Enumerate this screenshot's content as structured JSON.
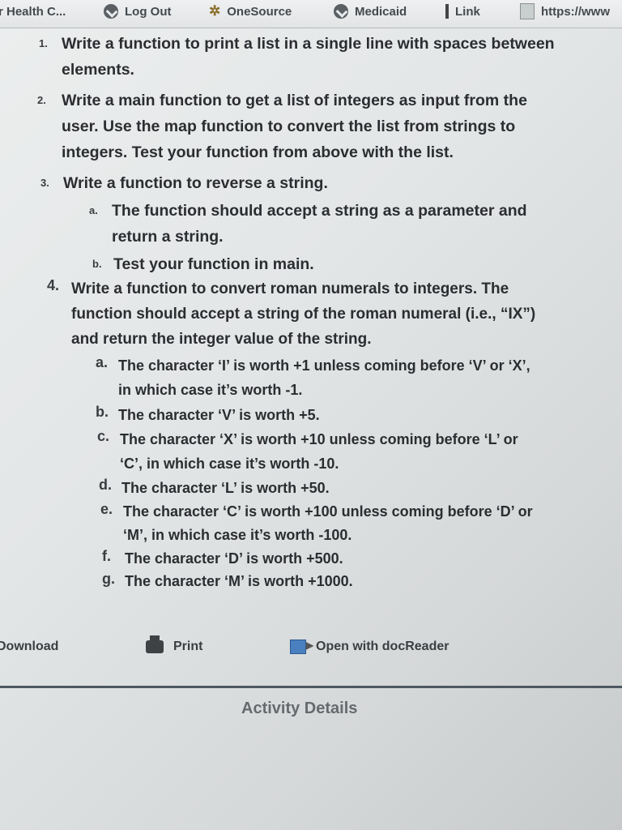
{
  "bookmarks": [
    {
      "label": "r Health C...",
      "icon": "none"
    },
    {
      "label": "Log Out",
      "icon": "check-circle-icon"
    },
    {
      "label": "OneSource",
      "icon": "gear-icon"
    },
    {
      "label": "Medicaid",
      "icon": "check-circle-icon"
    },
    {
      "label": "Link",
      "icon": "bar-icon"
    },
    {
      "label": "https://www",
      "icon": "document-icon"
    }
  ],
  "content": {
    "i1": {
      "num": "1.",
      "lines": [
        "Write a function to print a list in a single line with spaces between",
        "elements."
      ]
    },
    "i2": {
      "num": "2.",
      "lines": [
        "Write a main function to get a list of integers as input from the",
        "user. Use the map function to convert the list from strings to",
        "integers. Test your function from above with the list."
      ]
    },
    "i3": {
      "num": "3.",
      "lines": [
        "Write a function to reverse a string."
      ]
    },
    "i3a": {
      "num": "a.",
      "lines": [
        "The function should accept a string as a parameter and",
        "return a string."
      ]
    },
    "i3b": {
      "num": "b.",
      "lines": [
        "Test your function in main."
      ]
    },
    "i4": {
      "num": "4.",
      "lines": [
        "Write a function to convert roman numerals to integers. The",
        "function should accept a string of the roman numeral (i.e., “IX”)",
        "and return the integer value of the string."
      ]
    },
    "i4a": {
      "num": "a.",
      "lines": [
        "The character ‘I’ is worth +1 unless coming before ‘V’ or ‘X’,",
        "in which case it’s worth -1."
      ]
    },
    "i4b": {
      "num": "b.",
      "lines": [
        "The character ‘V’ is worth +5."
      ]
    },
    "i4c": {
      "num": "c.",
      "lines": [
        "The character ‘X’ is worth +10 unless coming before ‘L’ or",
        "‘C’, in which case it’s worth -10."
      ]
    },
    "i4d": {
      "num": "d.",
      "lines": [
        "The character ‘L’ is worth +50."
      ]
    },
    "i4e": {
      "num": "e.",
      "lines": [
        "The character ‘C’ is worth +100 unless coming before ‘D’ or",
        "‘M’, in which case it’s worth -100."
      ]
    },
    "i4f": {
      "num": "f.",
      "lines": [
        "The character ‘D’ is worth +500."
      ]
    },
    "i4g": {
      "num": "g.",
      "lines": [
        "The character ‘M’ is worth +1000."
      ]
    }
  },
  "toolbar": {
    "download": "Download",
    "print": "Print",
    "open_reader": "Open with docReader"
  },
  "activity_details": "Activity Details"
}
